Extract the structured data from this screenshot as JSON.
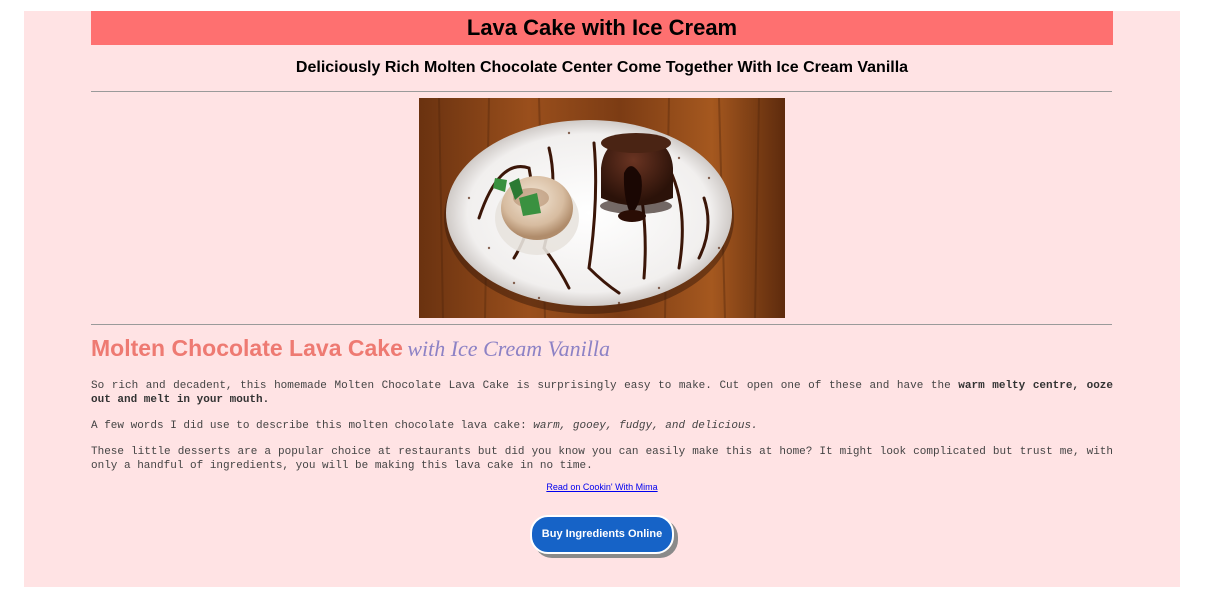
{
  "header": {
    "title": "Lava Cake with Ice Cream",
    "subtitle": "Deliciously Rich Molten Chocolate Center Come Together With Ice Cream Vanilla"
  },
  "image": {
    "alt": "Molten chocolate lava cake with ice cream vanilla on a plate"
  },
  "article": {
    "heading_main": "Molten Chocolate Lava Cake",
    "heading_accent": "with Ice Cream Vanilla",
    "p1_text": "So rich and decadent, this homemade Molten Chocolate Lava Cake is surprisingly easy to make. Cut open one of these and have the ",
    "p1_bold": "warm melty centre, ooze out and melt in your mouth.",
    "p2_text": "A few words I did use to describe this molten chocolate lava cake: ",
    "p2_italic": "warm, gooey, fudgy, and delicious.",
    "p3_text": "These little desserts are a popular choice at restaurants but did you know you can easily make this at home? It might look complicated but trust me, with only a handful of ingredients, you will be making this lava cake in no time.",
    "read_link": "Read on Cookin' With Mima"
  },
  "cta": {
    "buy_label": "Buy Ingredients Online"
  },
  "colors": {
    "page_bg": "#ffe3e4",
    "title_bar": "#fe7070",
    "heading_main": "#ee7a72",
    "heading_accent": "#8d82c5",
    "button": "#1663c7"
  }
}
